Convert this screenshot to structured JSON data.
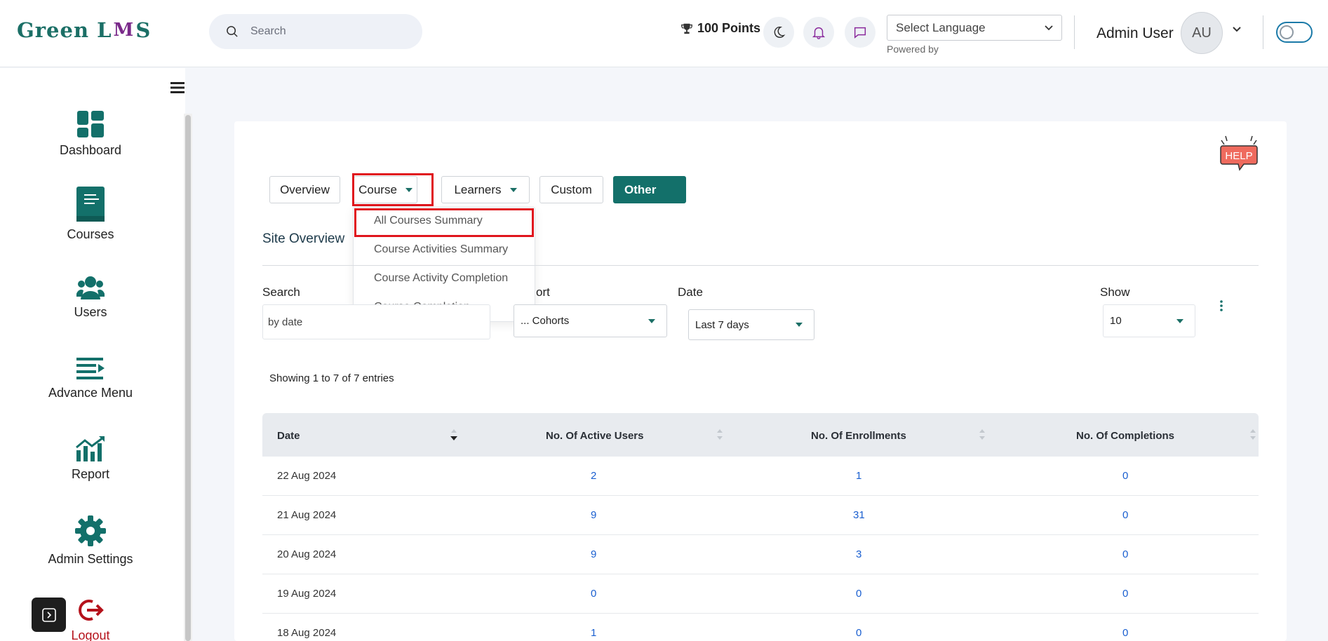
{
  "header": {
    "logo": {
      "left": "Green L",
      "cap": "M",
      "right": "S"
    },
    "search_placeholder": "Search",
    "points": "100 Points",
    "language_select": "Select Language",
    "powered_by": "Powered by",
    "user_name": "Admin User",
    "avatar_initials": "AU"
  },
  "sidebar": {
    "items": [
      {
        "label": "Dashboard"
      },
      {
        "label": "Courses"
      },
      {
        "label": "Users"
      },
      {
        "label": "Advance Menu"
      },
      {
        "label": "Report"
      },
      {
        "label": "Admin Settings"
      },
      {
        "label": "Logout"
      }
    ]
  },
  "help_badge": "HELP",
  "tabs": {
    "overview": "Overview",
    "course": "Course",
    "learners": "Learners",
    "custom": "Custom",
    "other": "Other"
  },
  "course_dropdown": {
    "items": [
      "All Courses Summary",
      "Course Activities Summary",
      "Course Activity Completion",
      "Course Completion"
    ]
  },
  "section_title": "Site Overview",
  "filters": {
    "search_label": "Search",
    "search_placeholder": "by date",
    "cohort_label": "ort",
    "cohort_value": "... Cohorts",
    "date_label": "Date",
    "date_value": "Last 7 days",
    "show_label": "Show",
    "show_value": "10"
  },
  "entries_info": "Showing 1 to 7 of 7 entries",
  "table": {
    "headers": [
      "Date",
      "No. Of Active Users",
      "No. Of Enrollments",
      "No. Of Completions"
    ],
    "rows": [
      {
        "date": "22 Aug 2024",
        "active": "2",
        "enroll": "1",
        "complete": "0"
      },
      {
        "date": "21 Aug 2024",
        "active": "9",
        "enroll": "31",
        "complete": "0"
      },
      {
        "date": "20 Aug 2024",
        "active": "9",
        "enroll": "3",
        "complete": "0"
      },
      {
        "date": "19 Aug 2024",
        "active": "0",
        "enroll": "0",
        "complete": "0"
      },
      {
        "date": "18 Aug 2024",
        "active": "1",
        "enroll": "0",
        "complete": "0"
      }
    ]
  },
  "colors": {
    "brand": "#13706a",
    "highlight": "#e0151d",
    "link": "#1a5fd0",
    "logout": "#b5121b"
  }
}
